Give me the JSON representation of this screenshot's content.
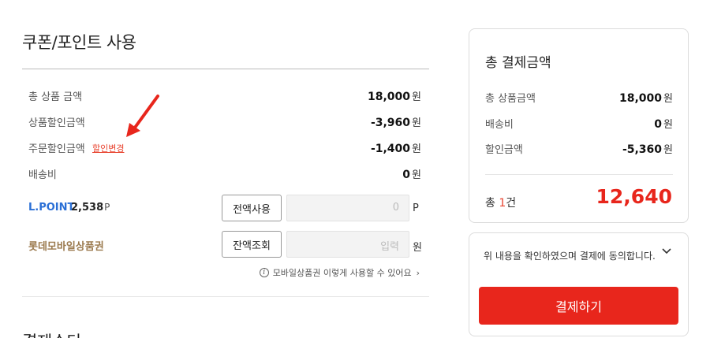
{
  "coupon": {
    "title": "쿠폰/포인트 사용",
    "rows": [
      {
        "label": "총 상품 금액",
        "amount": "18,000",
        "unit": "원"
      },
      {
        "label": "상품할인금액",
        "amount": "-3,960",
        "unit": "원"
      },
      {
        "label": "주문할인금액",
        "amount": "-1,400",
        "unit": "원",
        "link": "할인변경"
      },
      {
        "label": "배송비",
        "amount": "0",
        "unit": "원"
      }
    ],
    "lpoint": {
      "label": "L.POINT",
      "value": "2,538",
      "value_unit": "P",
      "button": "전액사용",
      "input_value": "0",
      "input_unit": "P"
    },
    "giftcard": {
      "label": "롯데모바일상품권",
      "button": "잔액조회",
      "input_placeholder": "입력",
      "input_unit": "원"
    },
    "note": "모바일상품권 이렇게 사용할 수 있어요",
    "note_chevron": "›",
    "info_icon": "i",
    "next_title": "결제수단"
  },
  "summary": {
    "title": "총 결제금액",
    "rows": [
      {
        "label": "총 상품금액",
        "amount": "18,000",
        "unit": "원"
      },
      {
        "label": "배송비",
        "amount": "0",
        "unit": "원"
      },
      {
        "label": "할인금액",
        "amount": "-5,360",
        "unit": "원"
      }
    ],
    "total_prefix": "총 ",
    "total_count": "1",
    "total_suffix": "건",
    "total_amount": "12,640"
  },
  "agree": {
    "text": "위 내용을 확인하였으며 결제에 동의합니다.",
    "pay_button": "결제하기"
  },
  "colors": {
    "accent": "#e8261c",
    "lpoint": "#2a6fd6",
    "giftcard": "#9b7a4e",
    "link": "#e8432f"
  }
}
